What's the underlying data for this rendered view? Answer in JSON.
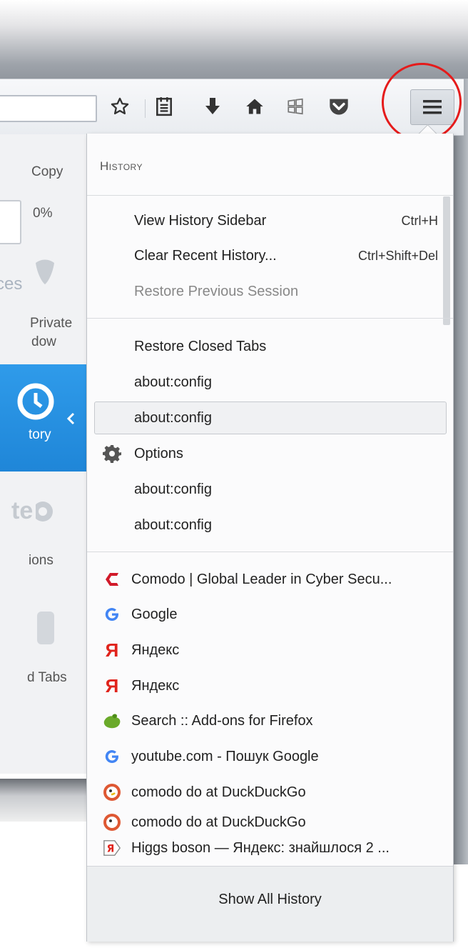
{
  "accent": {
    "highlight": "#1f86d8",
    "annotation": "#e51b1b"
  },
  "toolbar": {
    "icons": [
      "star-icon",
      "bookmarks-list-icon",
      "download-icon",
      "home-icon",
      "windows-icon",
      "pocket-icon",
      "hamburger-menu-icon"
    ]
  },
  "left_panel": {
    "copy": "Copy",
    "zoom": "0%",
    "ces": "ces",
    "private": "Private",
    "dow": "dow",
    "tory": "tory",
    "te": "te",
    "ions": "ions",
    "tabs": "d Tabs"
  },
  "history": {
    "title": "History",
    "items": [
      {
        "label": "View History Sidebar",
        "shortcut": "Ctrl+H"
      },
      {
        "label": "Clear Recent History...",
        "shortcut": "Ctrl+Shift+Del"
      },
      {
        "label": "Restore Previous Session",
        "disabled": true
      }
    ],
    "closed_tabs": [
      {
        "label": "Restore Closed Tabs"
      },
      {
        "label": "about:config"
      },
      {
        "label": "about:config",
        "selected": true
      },
      {
        "label": "Options",
        "icon": "gear-icon"
      },
      {
        "label": "about:config"
      },
      {
        "label": "about:config"
      }
    ],
    "recent": [
      {
        "label": "Comodo | Global Leader in Cyber Secu...",
        "icon": "comodo-icon"
      },
      {
        "label": "Google",
        "icon": "google-icon"
      },
      {
        "label": "Яндекс",
        "icon": "yandex-icon"
      },
      {
        "label": "Яндекс",
        "icon": "yandex-icon"
      },
      {
        "label": "Search :: Add-ons for Firefox",
        "icon": "addons-puzzle-icon"
      },
      {
        "label": "youtube.com - Пошук Google",
        "icon": "google-icon"
      },
      {
        "label": "comodo do at DuckDuckGo",
        "icon": "duckduckgo-icon"
      },
      {
        "label": "comodo do at DuckDuckGo",
        "icon": "duckduckgo-icon"
      },
      {
        "label": "Higgs boson — Яндекс: знайшлося 2 ...",
        "icon": "yandex-tab-icon"
      }
    ],
    "show_all": "Show All History"
  }
}
